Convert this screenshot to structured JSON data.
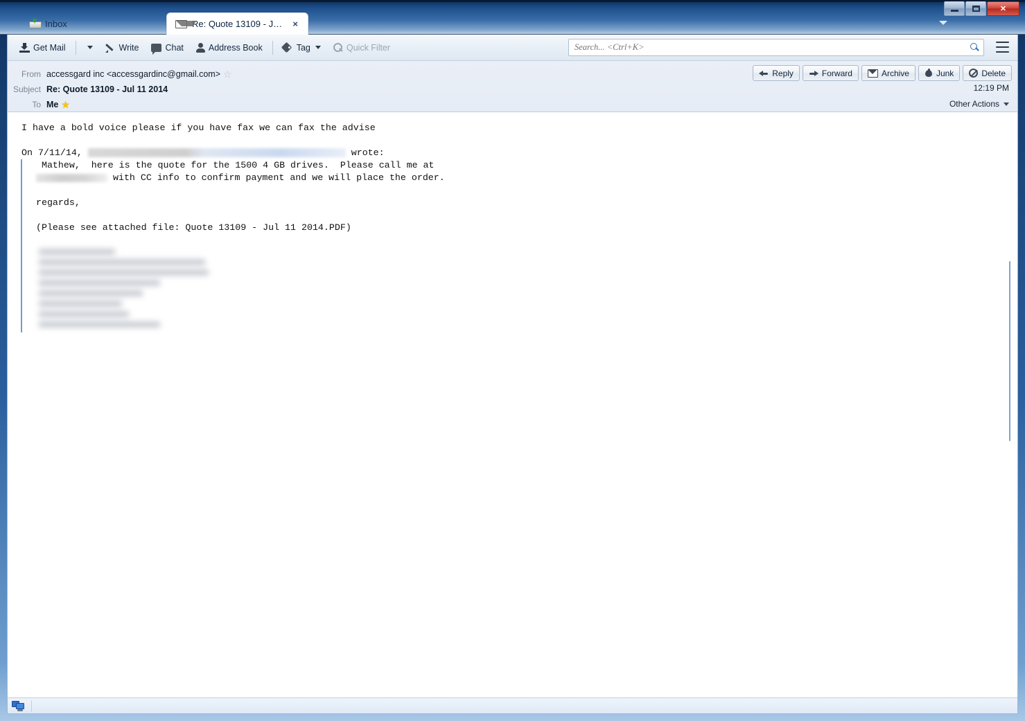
{
  "window": {
    "buttons": {
      "minimize": "Minimize",
      "maximize": "Maximize",
      "close": "Close"
    },
    "tab_menu": "tab-list-menu"
  },
  "tabs": [
    {
      "label": "Inbox",
      "icon": "inbox-icon",
      "active": false
    },
    {
      "label": "Re: Quote 13109 - Jul 11 2...",
      "icon": "envelope-icon",
      "active": true,
      "close": "×"
    }
  ],
  "toolbar": {
    "get_mail": "Get Mail",
    "get_mail_caret": "▾",
    "write": "Write",
    "chat": "Chat",
    "address_book": "Address Book",
    "tag": "Tag",
    "tag_caret": "▾",
    "quick_filter": "Quick Filter"
  },
  "search": {
    "value": "",
    "placeholder": "Search... <Ctrl+K>"
  },
  "message_header": {
    "from_label": "From",
    "from_value": "accessgard inc <accessgardinc@gmail.com>",
    "subject_label": "Subject",
    "subject_value": "Re: Quote 13109 - Jul 11 2014",
    "to_label": "To",
    "to_value": "Me",
    "time": "12:19 PM",
    "other_actions": "Other Actions",
    "other_actions_caret": "▾"
  },
  "header_actions": [
    {
      "label": "Reply",
      "icon": "reply-icon"
    },
    {
      "label": "Forward",
      "icon": "forward-icon"
    },
    {
      "label": "Archive",
      "icon": "archive-icon"
    },
    {
      "label": "Junk",
      "icon": "junk-icon"
    },
    {
      "label": "Delete",
      "icon": "delete-icon"
    }
  ],
  "body": {
    "reply_text": "I have a bold voice please if you have fax we can fax the advise",
    "attribution_prefix": "On 7/11/14, ",
    "attribution_suffix": " wrote:",
    "quote_line1_a": "  Mathew,  here is the quote for the 1500 4 GB drives.  Please call me at",
    "quote_line2_b": " with CC info to confirm payment and we will place the order.",
    "quote_regards": " regards,",
    "quote_attachment": " (Please see attached file: Quote 13109 - Jul 11 2014.PDF)"
  },
  "statusbar": {
    "text": "",
    "icon": "network-status-icon"
  },
  "colors": {
    "titlebar_blue": "#1d4e8b",
    "quote_bar": "#6f9ad3",
    "accent_link": "#2f6fb5",
    "close_red": "#d1473c",
    "star_filled": "#f5c518"
  }
}
